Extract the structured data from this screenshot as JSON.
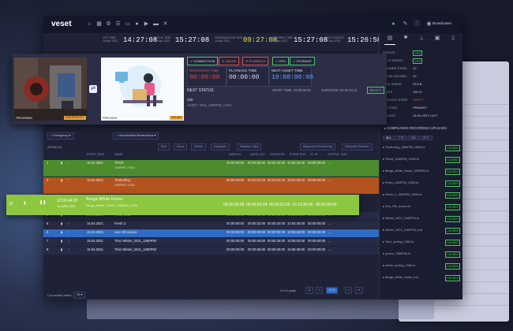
{
  "app": {
    "brand": "veset",
    "user": "Broadcaster"
  },
  "timebar": [
    {
      "label": "UTC TIME",
      "date": "15-Apr-2021",
      "time": "14:27:08"
    },
    {
      "label": "LOCAL TIME",
      "date": "15-Apr-2021",
      "time": "15:27:08"
    },
    {
      "label": "ORGANIZATION TIME",
      "date": "15-Apr-2021",
      "time": "09:27:08",
      "accent": true
    },
    {
      "label": "CHANNEL TIME",
      "date": "15-Apr-2021",
      "time": "15:27:08"
    },
    {
      "label": "LIVE SOURCE",
      "date": "15-Apr-2021",
      "time": "15:26:58"
    }
  ],
  "preview": {
    "program_label": "PROGRAM",
    "program_tag": "EMERGENCY",
    "preview_label": "PREVIEW",
    "preview_tag": "ON AIR",
    "status_buttons": [
      "CONNECTION",
      "CACHE",
      "PLAYBACK",
      "CPU",
      "STORAGE"
    ],
    "remaining_label": "REMAINING TIME",
    "remaining_value": "00:00:00",
    "playback_label": "PLAYBACK TIME",
    "playback_value": "00:00:00",
    "next_asset_label": "NEXT ASSET TIME",
    "next_asset_value": "10:00:00:00",
    "next_status": "NEXT STATUS",
    "start_time": "START TIME: 10:00:00:00",
    "duration": "DURATION: 00:02:01:11",
    "ready": "READY",
    "asset_id": "250",
    "asset_name": "ASSET: 2021_1080P50_H264"
  },
  "toolbar": {
    "dropdown1": "Emergency",
    "dropdown2": "Unscheduled Breakdowns",
    "zoom": "ZOOM (2)",
    "buttons": [
      "Edit",
      "Move",
      "Delete",
      "Duplicate",
      "Replace Clips"
    ],
    "right_buttons": [
      "Alignment Reordering",
      "Schedule Reorder"
    ]
  },
  "table": {
    "headers": [
      "EVENT DATE",
      "NAME",
      "MARK IN",
      "MARK OUT",
      "DURATION",
      "EVENT END",
      "TC IN",
      "OUTPUT / DAP"
    ],
    "rows": [
      {
        "idx": "1",
        "date": "15.04.2021",
        "time": "10:00:00",
        "name": "Tlmz5",
        "sub": "1080P50 / H264",
        "in": "00:00:00:00",
        "out": "00:00:32:00",
        "dur": "00:00:32:00",
        "end": "10:00:32:00",
        "tc": "00:00:00:00",
        "color": "#4c8b2e"
      },
      {
        "idx": "2",
        "date": "15.04.2021",
        "time": "10:00:32",
        "name": "Tlm5urfing",
        "sub": "1080P50 / H264",
        "in": "00:00:00:00",
        "out": "00:01:01:22",
        "dur": "00:01:01:22",
        "end": "10:01:33:22",
        "tc": "00:00:00:00",
        "color": "#b5531f"
      },
      {
        "idx": "3",
        "date": "15.04.2021",
        "time": "10:02:22",
        "name": "Berga White Horse",
        "sub": "1080P50 / H264",
        "in": "00:00:00:00",
        "out": "00:00:01:11",
        "dur": "00:00:01:11",
        "end": "10:02:01:11",
        "tc": "00:00:00:00",
        "color": "#8dc63f"
      },
      {
        "idx": "4",
        "date": "15.04.2021",
        "time": "10:03:34",
        "name": "Fresh 1080",
        "sub": "1080P50 / H264",
        "in": "00:00:00:00",
        "out": "00:00:42:00",
        "dur": "00:00:42:00",
        "end": "10:04:16:00",
        "tc": "00:00:00:00",
        "color": "#262a44"
      },
      {
        "idx": "5",
        "date": "15.04.2021",
        "time": "10:04:16",
        "name": "Fresh 2",
        "sub": "1080P50 / H264",
        "in": "00:00:00:00",
        "out": "00:00:32:00",
        "dur": "00:00:32:00",
        "end": "10:04:48:00",
        "tc": "00:00:00:00",
        "color": "#262a44"
      },
      {
        "idx": "6",
        "date": "15.04.2021",
        "time": "10:04:48",
        "name": "Live HD source",
        "sub": "Live / 1080i",
        "in": "00:00:00:00",
        "out": "00:00:30:00",
        "dur": "00:00:30:00",
        "end": "10:05:18:00",
        "tc": "00:00:00:00",
        "color": "#2f6bc5"
      },
      {
        "idx": "7",
        "date": "15.04.2021",
        "time": "10:05:18",
        "name": "Tlmz Winter_2021_1080P50",
        "sub": "1080P50 / H264",
        "in": "00:00:00:00",
        "out": "00:00:45:00",
        "dur": "00:00:45:00",
        "end": "10:06:03:00",
        "tc": "00:00:00:00",
        "color": "#262a44"
      },
      {
        "idx": "8",
        "date": "15.04.2021",
        "time": "10:06:03",
        "name": "Tlmz Winter_2021_1080P50",
        "sub": "1080P50 / H264",
        "in": "00:00:00:00",
        "out": "00:00:45:00",
        "dur": "00:00:45:00",
        "end": "10:06:48:00",
        "tc": "00:00:00:00",
        "color": "#262a44"
      }
    ],
    "highlight": {
      "idx": "10",
      "date": "12:02:44:22",
      "sub": "15-APR-2021",
      "name": "Berga White Horse",
      "meta": "Berga_White_Horse_1080p50_h264",
      "in": "00:00:00:00",
      "out": "00:00:03:04",
      "dur": "00:00:51:09",
      "end": "10:13:35:06",
      "tc": "00:00:00:00"
    },
    "footer": {
      "rows_label": "Connected peers",
      "rows_value": "10",
      "pager_label": "Go to page",
      "page": "1",
      "pages": "2",
      "next": "1 / 2"
    }
  },
  "sidebar": {
    "info": [
      {
        "k": "STATUS",
        "v": "YES"
      },
      {
        "k": "TITLE READY",
        "v": "YES"
      },
      {
        "k": "NUMBER ITEMS",
        "v": "10"
      },
      {
        "k": "ITEMS CACHED",
        "v": "10"
      },
      {
        "k": "DISK SPACE",
        "v": "25.9 B"
      },
      {
        "k": "STATE",
        "v": "100 %"
      },
      {
        "k": "PLAYOUT STATE",
        "v": "EMPTY"
      },
      {
        "k": "OPTIONS",
        "v": "PRIMARY"
      },
      {
        "k": "UPDATE",
        "v": "15-04-2021 14:27"
      }
    ],
    "section": "COMPLIANCE RECORDING UPLOADS",
    "filters": [
      "ALL",
      "TTE",
      "MB",
      "SPC"
    ],
    "files": [
      "Tlm5urfing_1080P50_H264.ts",
      "Tlmz5_1080P50_H264.ts",
      "Berga_White_Horse_1080P50.ts",
      "Fresh_1080P50_H264.ts",
      "Fresh_2_1080P50_H264.ts",
      "Live_HD_source.ts",
      "Winter_2021_1080P50.ts",
      "Winter_2021_1080P50_b.ts",
      "Tlmz_surfing_1080.ts",
      "promo_1080P50.ts",
      "winter_surfing_1080.ts",
      "Berga_White_Horse_b.ts"
    ],
    "cached_label": "CACHED"
  }
}
